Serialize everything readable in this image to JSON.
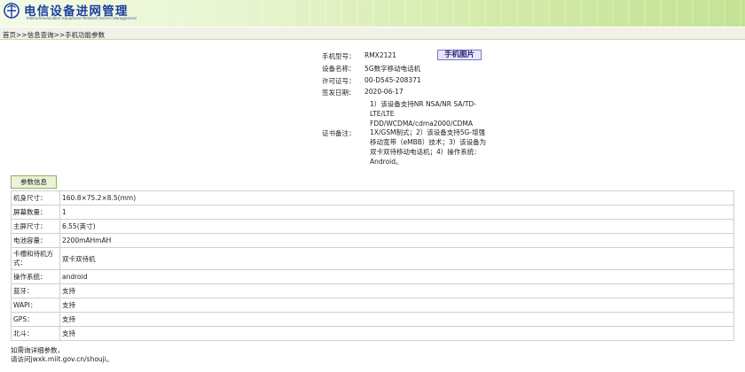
{
  "header": {
    "title_cn": "电信设备进网管理",
    "title_en": "Telecommunication Equipment Network Access Management",
    "logo_icon": "telecom-logo-icon"
  },
  "breadcrumb": {
    "home": "首页",
    "sep1": ">>",
    "query": "信息查询",
    "sep2": ">>",
    "current": "手机功能参数"
  },
  "device": {
    "model_label": "手机型号：",
    "model_value": "RMX2121",
    "photo_button": "手机图片",
    "name_label": "设备名称：",
    "name_value": "5G数字移动电话机",
    "license_label": "许可证号：",
    "license_value": "00-D545-208371",
    "date_label": "签发日期：",
    "date_value": "2020-06-17",
    "remark_label": "证书备注：",
    "remark_lines": [
      "1）该设备支持NR NSA/NR SA/TD-",
      "LTE/LTE",
      "FDD/WCDMA/cdma2000/CDMA",
      "1X/GSM制式；2）该设备支持5G-增强",
      "移动宽带（eMBB）技术；3）该设备为",
      "双卡双待移动电话机；4）操作系统：",
      "Android。"
    ]
  },
  "params": {
    "tab_label": "参数信息",
    "rows": [
      {
        "key": "机身尺寸：",
        "value": "160.8×75.2×8.5(mm)"
      },
      {
        "key": "屏幕数量：",
        "value": "1"
      },
      {
        "key": "主屏尺寸：",
        "value": "6.55(英寸)"
      },
      {
        "key": "电池容量：",
        "value": "2200mAHmAH"
      },
      {
        "key": "卡槽和待机方式：",
        "value": "双卡双待机"
      },
      {
        "key": "操作系统：",
        "value": "android"
      },
      {
        "key": "蓝牙：",
        "value": "支持"
      },
      {
        "key": "WAPI：",
        "value": "支持"
      },
      {
        "key": "GPS：",
        "value": "支持"
      },
      {
        "key": "北斗：",
        "value": "支持"
      }
    ]
  },
  "footer": {
    "line1": "如需询详细参数，",
    "line2": "请访问jwxk.miit.gov.cn/shouji。"
  },
  "colors": {
    "brand_blue": "#1a3f9e",
    "header_green": "#d3ebaa",
    "button_purple": "#7a76c8"
  }
}
